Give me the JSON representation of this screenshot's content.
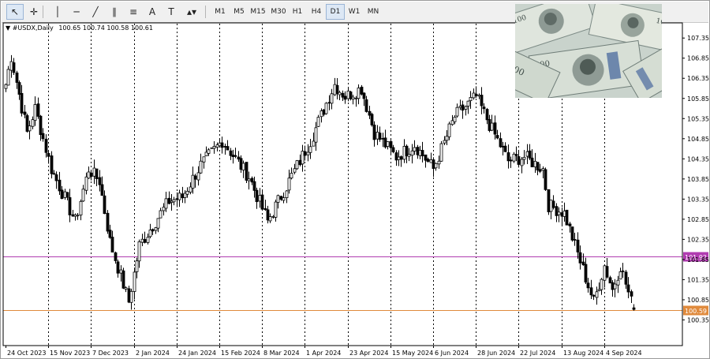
{
  "toolbar": {
    "tools": [
      {
        "name": "cursor-icon",
        "glyph": "↖"
      },
      {
        "name": "crosshair-icon",
        "glyph": "✛"
      },
      {
        "name": "vertical-line-icon",
        "glyph": "│"
      },
      {
        "name": "horizontal-line-icon",
        "glyph": "─"
      },
      {
        "name": "trendline-icon",
        "glyph": "╱"
      },
      {
        "name": "equidistant-channel-icon",
        "glyph": "∥"
      },
      {
        "name": "fibonacci-icon",
        "glyph": "≡"
      },
      {
        "name": "text-icon",
        "glyph": "A"
      },
      {
        "name": "text-label-icon",
        "glyph": "T"
      },
      {
        "name": "shapes-dropdown-icon",
        "glyph": "▴▾"
      }
    ],
    "timeframes": [
      "M1",
      "M5",
      "M15",
      "M30",
      "H1",
      "H4",
      "D1",
      "W1",
      "MN"
    ],
    "active_timeframe": "D1"
  },
  "chart": {
    "symbol_label": "#USDX,Daily",
    "ohlc_text": "100.65 100.74 100.58 100.61",
    "price_ticks": [
      "107.35",
      "106.85",
      "106.35",
      "105.85",
      "105.35",
      "104.85",
      "104.35",
      "103.85",
      "103.35",
      "102.85",
      "102.35",
      "101.85",
      "101.35",
      "100.85",
      "100.35"
    ],
    "date_ticks": [
      "24 Oct 2023",
      "15 Nov 2023",
      "7 Dec 2023",
      "2 Jan 2024",
      "24 Jan 2024",
      "15 Feb 2024",
      "8 Mar 2024",
      "1 Apr 2024",
      "23 Apr 2024",
      "15 May 2024",
      "6 Jun 2024",
      "28 Jun 2024",
      "22 Jul 2024",
      "13 Aug 2024",
      "4 Sep 2024"
    ],
    "levels": [
      {
        "price": "101.92",
        "value": 101.92,
        "color": "#b03cb0"
      },
      {
        "price": "100.59",
        "value": 100.59,
        "color": "#e08a3c"
      }
    ],
    "colors": {
      "candle_up": "#ffffff",
      "candle_down": "#000000",
      "wick": "#000000",
      "grid": "#000000",
      "background": "#ffffff"
    }
  },
  "chart_data": {
    "type": "candlestick",
    "timeframe": "D1",
    "symbol": "#USDX",
    "y_range": [
      100.3,
      107.55
    ],
    "grid": "vertical dotted separators",
    "anchors": [
      {
        "date": "2023-10-24",
        "close": 106.2
      },
      {
        "date": "2023-10-26",
        "close": 106.9
      },
      {
        "date": "2023-11-03",
        "close": 105.0
      },
      {
        "date": "2023-11-08",
        "close": 105.6
      },
      {
        "date": "2023-11-16",
        "close": 104.1
      },
      {
        "date": "2023-11-29",
        "close": 102.8
      },
      {
        "date": "2023-12-06",
        "close": 104.1
      },
      {
        "date": "2023-12-12",
        "close": 103.8
      },
      {
        "date": "2023-12-18",
        "close": 102.3
      },
      {
        "date": "2023-12-27",
        "close": 100.8
      },
      {
        "date": "2024-01-02",
        "close": 102.2
      },
      {
        "date": "2024-01-17",
        "close": 103.3
      },
      {
        "date": "2024-01-24",
        "close": 103.4
      },
      {
        "date": "2024-02-02",
        "close": 104.2
      },
      {
        "date": "2024-02-14",
        "close": 104.8
      },
      {
        "date": "2024-02-28",
        "close": 103.9
      },
      {
        "date": "2024-03-08",
        "close": 102.8
      },
      {
        "date": "2024-03-20",
        "close": 103.8
      },
      {
        "date": "2024-04-01",
        "close": 104.8
      },
      {
        "date": "2024-04-12",
        "close": 106.2
      },
      {
        "date": "2024-04-18",
        "close": 105.9
      },
      {
        "date": "2024-04-26",
        "close": 106.1
      },
      {
        "date": "2024-05-03",
        "close": 105.0
      },
      {
        "date": "2024-05-15",
        "close": 104.4
      },
      {
        "date": "2024-05-24",
        "close": 104.7
      },
      {
        "date": "2024-06-04",
        "close": 104.1
      },
      {
        "date": "2024-06-14",
        "close": 105.4
      },
      {
        "date": "2024-06-26",
        "close": 105.9
      },
      {
        "date": "2024-07-03",
        "close": 105.2
      },
      {
        "date": "2024-07-12",
        "close": 104.3
      },
      {
        "date": "2024-07-22",
        "close": 104.4
      },
      {
        "date": "2024-07-31",
        "close": 104.1
      },
      {
        "date": "2024-08-02",
        "close": 103.2
      },
      {
        "date": "2024-08-12",
        "close": 103.0
      },
      {
        "date": "2024-08-16",
        "close": 102.2
      },
      {
        "date": "2024-08-22",
        "close": 101.4
      },
      {
        "date": "2024-08-27",
        "close": 100.8
      },
      {
        "date": "2024-09-02",
        "close": 101.7
      },
      {
        "date": "2024-09-05",
        "close": 101.1
      },
      {
        "date": "2024-09-10",
        "close": 101.7
      },
      {
        "date": "2024-09-16",
        "close": 100.8
      },
      {
        "date": "2024-09-17",
        "close": 100.61
      }
    ],
    "last_bar": {
      "open": 100.65,
      "high": 100.74,
      "low": 100.58,
      "close": 100.61
    }
  }
}
